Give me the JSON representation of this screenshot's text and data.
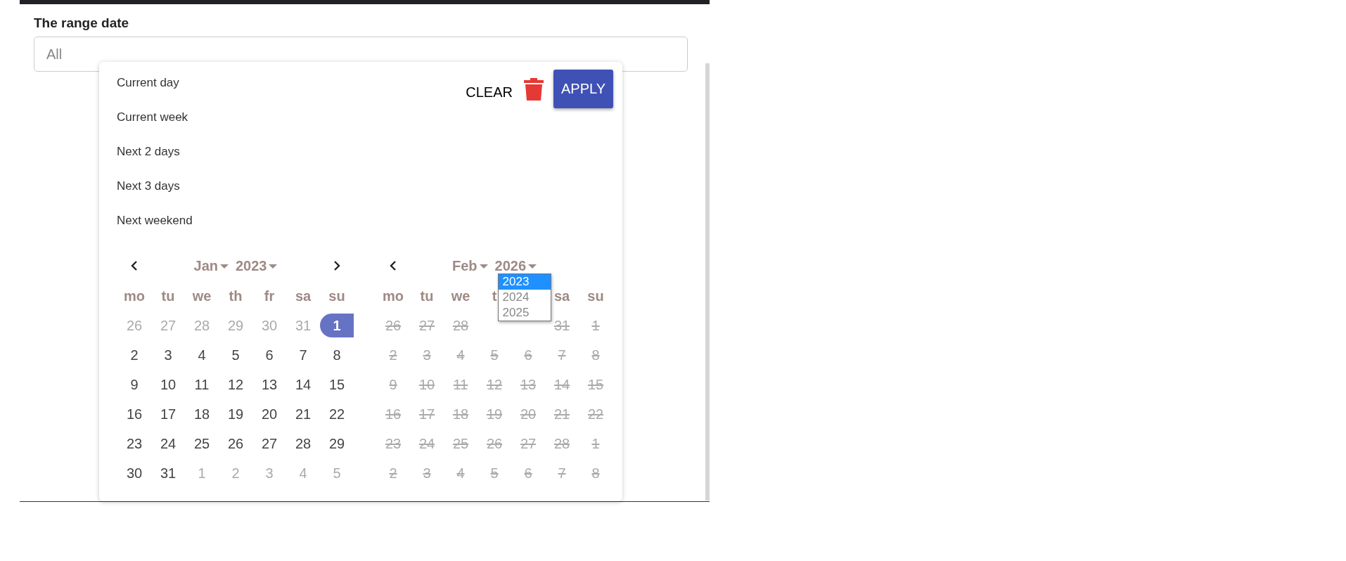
{
  "field": {
    "label": "The range date",
    "placeholder": "All"
  },
  "presets": [
    {
      "label": "Current day"
    },
    {
      "label": "Current week"
    },
    {
      "label": "Next 2 days"
    },
    {
      "label": "Next 3 days"
    },
    {
      "label": "Next weekend"
    }
  ],
  "actions": {
    "clear": "CLEAR",
    "apply": "APPLY"
  },
  "calendars": [
    {
      "month": "Jan",
      "year": "2023",
      "show_prev": true,
      "show_next": true,
      "weekdays": [
        "mo",
        "tu",
        "we",
        "th",
        "fr",
        "sa",
        "su"
      ],
      "weeks": [
        [
          {
            "label": "26",
            "kind": "outside",
            "selected": false
          },
          {
            "label": "27",
            "kind": "outside",
            "selected": false
          },
          {
            "label": "28",
            "kind": "outside",
            "selected": false
          },
          {
            "label": "29",
            "kind": "outside",
            "selected": false
          },
          {
            "label": "30",
            "kind": "outside",
            "selected": false
          },
          {
            "label": "31",
            "kind": "outside",
            "selected": false
          },
          {
            "label": "1",
            "kind": "day",
            "selected": true
          }
        ],
        [
          {
            "label": "2",
            "kind": "day",
            "selected": false
          },
          {
            "label": "3",
            "kind": "day",
            "selected": false
          },
          {
            "label": "4",
            "kind": "day",
            "selected": false
          },
          {
            "label": "5",
            "kind": "day",
            "selected": false
          },
          {
            "label": "6",
            "kind": "day",
            "selected": false
          },
          {
            "label": "7",
            "kind": "day",
            "selected": false
          },
          {
            "label": "8",
            "kind": "day",
            "selected": false
          }
        ],
        [
          {
            "label": "9",
            "kind": "day",
            "selected": false
          },
          {
            "label": "10",
            "kind": "day",
            "selected": false
          },
          {
            "label": "11",
            "kind": "day",
            "selected": false
          },
          {
            "label": "12",
            "kind": "day",
            "selected": false
          },
          {
            "label": "13",
            "kind": "day",
            "selected": false
          },
          {
            "label": "14",
            "kind": "day",
            "selected": false
          },
          {
            "label": "15",
            "kind": "day",
            "selected": false
          }
        ],
        [
          {
            "label": "16",
            "kind": "day",
            "selected": false
          },
          {
            "label": "17",
            "kind": "day",
            "selected": false
          },
          {
            "label": "18",
            "kind": "day",
            "selected": false
          },
          {
            "label": "19",
            "kind": "day",
            "selected": false
          },
          {
            "label": "20",
            "kind": "day",
            "selected": false
          },
          {
            "label": "21",
            "kind": "day",
            "selected": false
          },
          {
            "label": "22",
            "kind": "day",
            "selected": false
          }
        ],
        [
          {
            "label": "23",
            "kind": "day",
            "selected": false
          },
          {
            "label": "24",
            "kind": "day",
            "selected": false
          },
          {
            "label": "25",
            "kind": "day",
            "selected": false
          },
          {
            "label": "26",
            "kind": "day",
            "selected": false
          },
          {
            "label": "27",
            "kind": "day",
            "selected": false
          },
          {
            "label": "28",
            "kind": "day",
            "selected": false
          },
          {
            "label": "29",
            "kind": "day",
            "selected": false
          }
        ],
        [
          {
            "label": "30",
            "kind": "day",
            "selected": false
          },
          {
            "label": "31",
            "kind": "day",
            "selected": false
          },
          {
            "label": "1",
            "kind": "outside",
            "selected": false
          },
          {
            "label": "2",
            "kind": "outside",
            "selected": false
          },
          {
            "label": "3",
            "kind": "outside",
            "selected": false
          },
          {
            "label": "4",
            "kind": "outside",
            "selected": false
          },
          {
            "label": "5",
            "kind": "outside",
            "selected": false
          }
        ]
      ]
    },
    {
      "month": "Feb",
      "year": "2026",
      "show_prev": true,
      "show_next": false,
      "year_options": [
        {
          "label": "2023",
          "selected": true
        },
        {
          "label": "2024",
          "selected": false
        },
        {
          "label": "2025",
          "selected": false
        }
      ],
      "weekdays": [
        "mo",
        "tu",
        "we",
        "t",
        {
          "kind": "covered"
        },
        "sa",
        "su"
      ],
      "weeks": [
        [
          {
            "label": "26",
            "kind": "disabled",
            "selected": false
          },
          {
            "label": "27",
            "kind": "disabled",
            "selected": false
          },
          {
            "label": "28",
            "kind": "disabled",
            "selected": false
          },
          {
            "kind": "covered"
          },
          {
            "kind": "covered"
          },
          {
            "label": "31",
            "kind": "disabled",
            "selected": false
          },
          {
            "label": "1",
            "kind": "disabled",
            "selected": false
          }
        ],
        [
          {
            "label": "2",
            "kind": "disabled",
            "selected": false
          },
          {
            "label": "3",
            "kind": "disabled",
            "selected": false
          },
          {
            "label": "4",
            "kind": "disabled",
            "selected": false
          },
          {
            "label": "5",
            "kind": "disabled",
            "selected": false
          },
          {
            "label": "6",
            "kind": "disabled",
            "selected": false
          },
          {
            "label": "7",
            "kind": "disabled",
            "selected": false
          },
          {
            "label": "8",
            "kind": "disabled",
            "selected": false
          }
        ],
        [
          {
            "label": "9",
            "kind": "disabled",
            "selected": false
          },
          {
            "label": "10",
            "kind": "disabled",
            "selected": false
          },
          {
            "label": "11",
            "kind": "disabled",
            "selected": false
          },
          {
            "label": "12",
            "kind": "disabled",
            "selected": false
          },
          {
            "label": "13",
            "kind": "disabled",
            "selected": false
          },
          {
            "label": "14",
            "kind": "disabled",
            "selected": false
          },
          {
            "label": "15",
            "kind": "disabled",
            "selected": false
          }
        ],
        [
          {
            "label": "16",
            "kind": "disabled",
            "selected": false
          },
          {
            "label": "17",
            "kind": "disabled",
            "selected": false
          },
          {
            "label": "18",
            "kind": "disabled",
            "selected": false
          },
          {
            "label": "19",
            "kind": "disabled",
            "selected": false
          },
          {
            "label": "20",
            "kind": "disabled",
            "selected": false
          },
          {
            "label": "21",
            "kind": "disabled",
            "selected": false
          },
          {
            "label": "22",
            "kind": "disabled",
            "selected": false
          }
        ],
        [
          {
            "label": "23",
            "kind": "disabled",
            "selected": false
          },
          {
            "label": "24",
            "kind": "disabled",
            "selected": false
          },
          {
            "label": "25",
            "kind": "disabled",
            "selected": false
          },
          {
            "label": "26",
            "kind": "disabled",
            "selected": false
          },
          {
            "label": "27",
            "kind": "disabled",
            "selected": false
          },
          {
            "label": "28",
            "kind": "disabled",
            "selected": false
          },
          {
            "label": "1",
            "kind": "disabled",
            "selected": false
          }
        ],
        [
          {
            "label": "2",
            "kind": "disabled",
            "selected": false
          },
          {
            "label": "3",
            "kind": "disabled",
            "selected": false
          },
          {
            "label": "4",
            "kind": "disabled",
            "selected": false
          },
          {
            "label": "5",
            "kind": "disabled",
            "selected": false
          },
          {
            "label": "6",
            "kind": "disabled",
            "selected": false
          },
          {
            "label": "7",
            "kind": "disabled",
            "selected": false
          },
          {
            "label": "8",
            "kind": "disabled",
            "selected": false
          }
        ]
      ]
    }
  ]
}
